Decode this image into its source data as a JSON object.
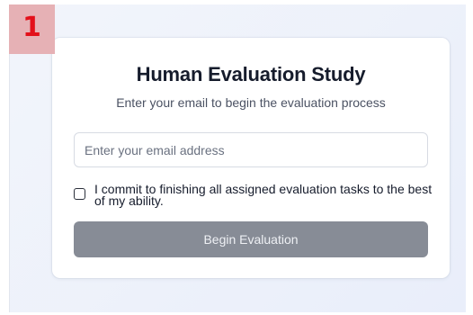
{
  "step_badge": {
    "number": "1"
  },
  "card": {
    "title": "Human Evaluation Study",
    "subtitle": "Enter your email to begin the evaluation process",
    "email_field": {
      "value": "",
      "placeholder": "Enter your email address"
    },
    "commitment": {
      "checked": false,
      "label": "I commit to finishing all assigned evaluation tasks to the best of my ability."
    },
    "begin_button": {
      "label": "Begin Evaluation",
      "disabled": true
    }
  },
  "colors": {
    "badge_bg": "#e6b1b5",
    "badge_text": "#e3101a",
    "button_disabled_bg": "#878c96",
    "page_bg": "#edf1fa"
  }
}
